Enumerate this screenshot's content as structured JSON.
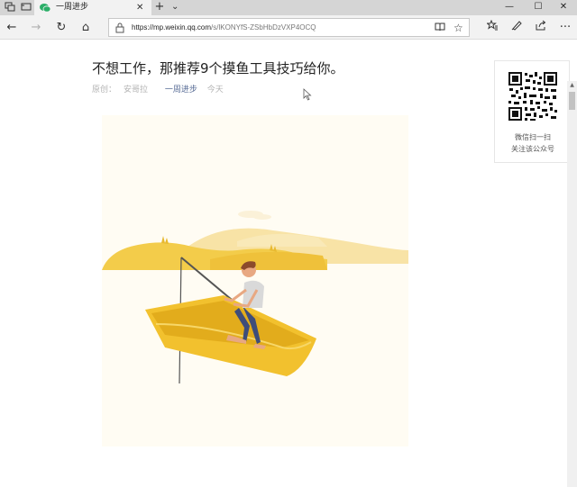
{
  "browser": {
    "tab": {
      "title": "一周进步",
      "close": "✕"
    },
    "new_tab": "+",
    "tab_list": "⌄",
    "window": {
      "minimize": "—",
      "maximize": "☐",
      "close": "✕"
    },
    "nav": {
      "back": "←",
      "forward": "→",
      "refresh": "↻",
      "home": "⌂"
    },
    "address": {
      "url_host": "https://mp.weixin.qq.com",
      "url_path": "/s/lKONYfS-ZSbHbDzVXP4OCQ"
    },
    "icons": [
      "lock-icon",
      "reading-view-icon",
      "star-icon",
      "favorites-icon",
      "notes-icon",
      "share-icon",
      "more-icon"
    ]
  },
  "article": {
    "title": "不想工作，那推荐9个摸鱼工具技巧给你。",
    "original_label": "原创：",
    "author": "安哥拉",
    "account": "一周进步",
    "date": "今天"
  },
  "qr_panel": {
    "line1": "微信扫一扫",
    "line2": "关注该公众号"
  },
  "colors": {
    "link": "#576b95",
    "muted": "#b2b2b2",
    "boat": "#f2c12e",
    "hill": "#f3cc4a"
  }
}
